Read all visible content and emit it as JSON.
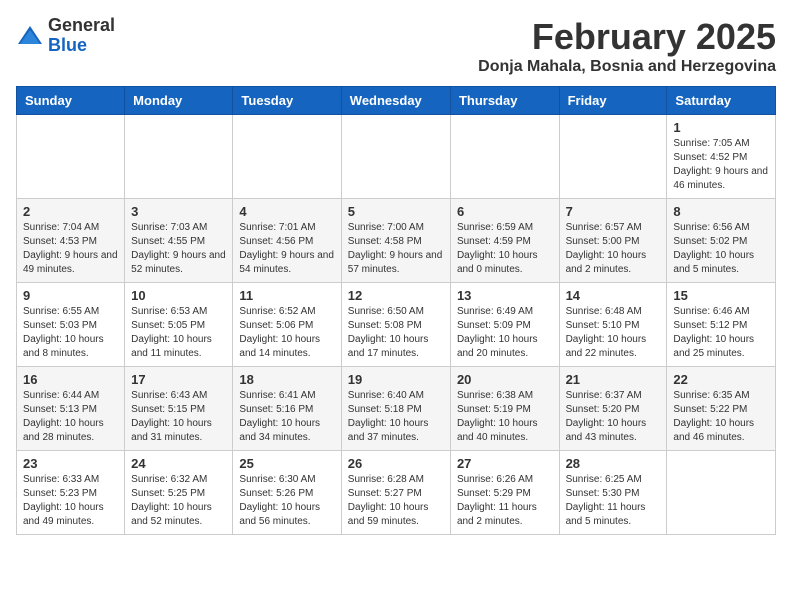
{
  "logo": {
    "general": "General",
    "blue": "Blue"
  },
  "header": {
    "month": "February 2025",
    "location": "Donja Mahala, Bosnia and Herzegovina"
  },
  "weekdays": [
    "Sunday",
    "Monday",
    "Tuesday",
    "Wednesday",
    "Thursday",
    "Friday",
    "Saturday"
  ],
  "weeks": [
    [
      {
        "day": "",
        "info": ""
      },
      {
        "day": "",
        "info": ""
      },
      {
        "day": "",
        "info": ""
      },
      {
        "day": "",
        "info": ""
      },
      {
        "day": "",
        "info": ""
      },
      {
        "day": "",
        "info": ""
      },
      {
        "day": "1",
        "info": "Sunrise: 7:05 AM\nSunset: 4:52 PM\nDaylight: 9 hours and 46 minutes."
      }
    ],
    [
      {
        "day": "2",
        "info": "Sunrise: 7:04 AM\nSunset: 4:53 PM\nDaylight: 9 hours and 49 minutes."
      },
      {
        "day": "3",
        "info": "Sunrise: 7:03 AM\nSunset: 4:55 PM\nDaylight: 9 hours and 52 minutes."
      },
      {
        "day": "4",
        "info": "Sunrise: 7:01 AM\nSunset: 4:56 PM\nDaylight: 9 hours and 54 minutes."
      },
      {
        "day": "5",
        "info": "Sunrise: 7:00 AM\nSunset: 4:58 PM\nDaylight: 9 hours and 57 minutes."
      },
      {
        "day": "6",
        "info": "Sunrise: 6:59 AM\nSunset: 4:59 PM\nDaylight: 10 hours and 0 minutes."
      },
      {
        "day": "7",
        "info": "Sunrise: 6:57 AM\nSunset: 5:00 PM\nDaylight: 10 hours and 2 minutes."
      },
      {
        "day": "8",
        "info": "Sunrise: 6:56 AM\nSunset: 5:02 PM\nDaylight: 10 hours and 5 minutes."
      }
    ],
    [
      {
        "day": "9",
        "info": "Sunrise: 6:55 AM\nSunset: 5:03 PM\nDaylight: 10 hours and 8 minutes."
      },
      {
        "day": "10",
        "info": "Sunrise: 6:53 AM\nSunset: 5:05 PM\nDaylight: 10 hours and 11 minutes."
      },
      {
        "day": "11",
        "info": "Sunrise: 6:52 AM\nSunset: 5:06 PM\nDaylight: 10 hours and 14 minutes."
      },
      {
        "day": "12",
        "info": "Sunrise: 6:50 AM\nSunset: 5:08 PM\nDaylight: 10 hours and 17 minutes."
      },
      {
        "day": "13",
        "info": "Sunrise: 6:49 AM\nSunset: 5:09 PM\nDaylight: 10 hours and 20 minutes."
      },
      {
        "day": "14",
        "info": "Sunrise: 6:48 AM\nSunset: 5:10 PM\nDaylight: 10 hours and 22 minutes."
      },
      {
        "day": "15",
        "info": "Sunrise: 6:46 AM\nSunset: 5:12 PM\nDaylight: 10 hours and 25 minutes."
      }
    ],
    [
      {
        "day": "16",
        "info": "Sunrise: 6:44 AM\nSunset: 5:13 PM\nDaylight: 10 hours and 28 minutes."
      },
      {
        "day": "17",
        "info": "Sunrise: 6:43 AM\nSunset: 5:15 PM\nDaylight: 10 hours and 31 minutes."
      },
      {
        "day": "18",
        "info": "Sunrise: 6:41 AM\nSunset: 5:16 PM\nDaylight: 10 hours and 34 minutes."
      },
      {
        "day": "19",
        "info": "Sunrise: 6:40 AM\nSunset: 5:18 PM\nDaylight: 10 hours and 37 minutes."
      },
      {
        "day": "20",
        "info": "Sunrise: 6:38 AM\nSunset: 5:19 PM\nDaylight: 10 hours and 40 minutes."
      },
      {
        "day": "21",
        "info": "Sunrise: 6:37 AM\nSunset: 5:20 PM\nDaylight: 10 hours and 43 minutes."
      },
      {
        "day": "22",
        "info": "Sunrise: 6:35 AM\nSunset: 5:22 PM\nDaylight: 10 hours and 46 minutes."
      }
    ],
    [
      {
        "day": "23",
        "info": "Sunrise: 6:33 AM\nSunset: 5:23 PM\nDaylight: 10 hours and 49 minutes."
      },
      {
        "day": "24",
        "info": "Sunrise: 6:32 AM\nSunset: 5:25 PM\nDaylight: 10 hours and 52 minutes."
      },
      {
        "day": "25",
        "info": "Sunrise: 6:30 AM\nSunset: 5:26 PM\nDaylight: 10 hours and 56 minutes."
      },
      {
        "day": "26",
        "info": "Sunrise: 6:28 AM\nSunset: 5:27 PM\nDaylight: 10 hours and 59 minutes."
      },
      {
        "day": "27",
        "info": "Sunrise: 6:26 AM\nSunset: 5:29 PM\nDaylight: 11 hours and 2 minutes."
      },
      {
        "day": "28",
        "info": "Sunrise: 6:25 AM\nSunset: 5:30 PM\nDaylight: 11 hours and 5 minutes."
      },
      {
        "day": "",
        "info": ""
      }
    ]
  ]
}
